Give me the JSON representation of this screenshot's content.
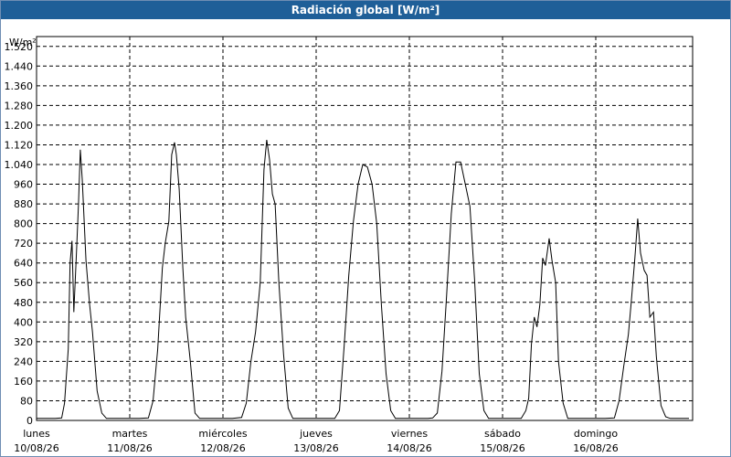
{
  "window": {
    "title": "Radiación global [W/m²]"
  },
  "chart_data": {
    "type": "line",
    "title": "Radiación global [W/m²]",
    "ylabel": "W/m²",
    "ylim": [
      0,
      1560
    ],
    "yticks": [
      0,
      80,
      160,
      240,
      320,
      400,
      480,
      560,
      640,
      720,
      800,
      880,
      960,
      1040,
      1120,
      1200,
      1280,
      1360,
      1440,
      1520
    ],
    "ytick_labels": [
      "0",
      "80",
      "160",
      "240",
      "320",
      "400",
      "480",
      "560",
      "640",
      "720",
      "800",
      "880",
      "960",
      "1.040",
      "1.120",
      "1.200",
      "1.280",
      "1.360",
      "1.440",
      "1.520"
    ],
    "xlim": [
      0,
      7.1
    ],
    "days": [
      {
        "name": "lunes",
        "date": "10/08/26"
      },
      {
        "name": "martes",
        "date": "11/08/26"
      },
      {
        "name": "miércoles",
        "date": "12/08/26"
      },
      {
        "name": "jueves",
        "date": "13/08/26"
      },
      {
        "name": "viernes",
        "date": "14/08/26"
      },
      {
        "name": "sábado",
        "date": "15/08/26"
      },
      {
        "name": "domingo",
        "date": "16/08/26"
      }
    ],
    "grid": true,
    "line_color": "#000000",
    "x": [
      0,
      0.1,
      0.2,
      0.27,
      0.3,
      0.34,
      0.36,
      0.38,
      0.4,
      0.43,
      0.45,
      0.47,
      0.49,
      0.5,
      0.53,
      0.57,
      0.6,
      0.65,
      0.7,
      0.75,
      0.8,
      0.85,
      0.9,
      1.0,
      1.1,
      1.2,
      1.25,
      1.3,
      1.35,
      1.38,
      1.42,
      1.45,
      1.48,
      1.5,
      1.53,
      1.57,
      1.6,
      1.65,
      1.7,
      1.75,
      1.8,
      1.85,
      1.9,
      2.0,
      2.1,
      2.2,
      2.25,
      2.3,
      2.35,
      2.4,
      2.44,
      2.47,
      2.5,
      2.53,
      2.56,
      2.6,
      2.65,
      2.7,
      2.75,
      2.8,
      2.85,
      2.9,
      3.0,
      3.1,
      3.2,
      3.25,
      3.3,
      3.35,
      3.4,
      3.45,
      3.5,
      3.55,
      3.6,
      3.65,
      3.7,
      3.75,
      3.8,
      3.85,
      3.9,
      4.0,
      4.1,
      4.2,
      4.25,
      4.3,
      4.35,
      4.4,
      4.45,
      4.5,
      4.55,
      4.6,
      4.65,
      4.7,
      4.75,
      4.8,
      4.85,
      4.9,
      5.0,
      5.1,
      5.2,
      5.25,
      5.28,
      5.31,
      5.34,
      5.37,
      5.4,
      5.43,
      5.46,
      5.5,
      5.53,
      5.57,
      5.6,
      5.65,
      5.7,
      5.75,
      5.8,
      5.85,
      5.9,
      6.0,
      6.1,
      6.2,
      6.25,
      6.3,
      6.35,
      6.38,
      6.42,
      6.45,
      6.48,
      6.52,
      6.55,
      6.58,
      6.62,
      6.65,
      6.7,
      6.75,
      6.8,
      6.9,
      7.0
    ],
    "y": [
      8,
      8,
      8,
      10,
      70,
      290,
      640,
      730,
      440,
      700,
      880,
      1100,
      980,
      900,
      650,
      470,
      360,
      120,
      30,
      8,
      8,
      8,
      8,
      8,
      8,
      10,
      80,
      290,
      620,
      720,
      810,
      1080,
      1130,
      1080,
      940,
      620,
      420,
      240,
      30,
      8,
      8,
      8,
      8,
      8,
      8,
      12,
      70,
      240,
      360,
      560,
      1020,
      1140,
      1060,
      920,
      880,
      560,
      270,
      50,
      8,
      8,
      8,
      8,
      8,
      8,
      8,
      40,
      300,
      590,
      810,
      960,
      1040,
      1030,
      960,
      800,
      470,
      190,
      40,
      8,
      8,
      8,
      8,
      8,
      10,
      30,
      200,
      510,
      840,
      1050,
      1050,
      960,
      870,
      570,
      190,
      40,
      8,
      8,
      8,
      8,
      8,
      40,
      90,
      310,
      420,
      380,
      470,
      660,
      630,
      740,
      650,
      560,
      240,
      70,
      8,
      8,
      8,
      8,
      8,
      8,
      8,
      10,
      80,
      220,
      350,
      480,
      660,
      820,
      680,
      610,
      590,
      420,
      440,
      260,
      60,
      15,
      8,
      8,
      8
    ]
  }
}
